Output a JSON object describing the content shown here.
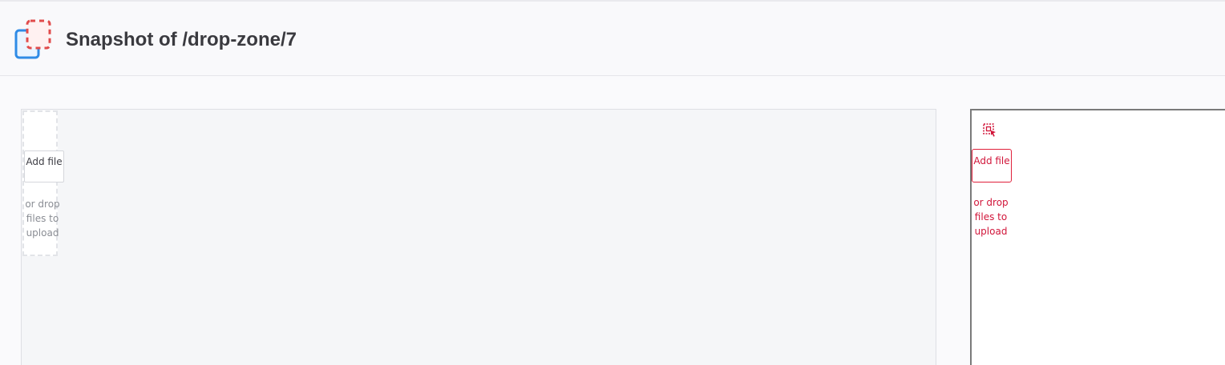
{
  "header": {
    "title": "Snapshot of /drop-zone/7"
  },
  "icons": {
    "logo": "snapshot-logo-icon",
    "select": "dashed-select-icon"
  },
  "left_panel": {
    "add_file_label": "Add file",
    "drop_text": "or drop files to upload"
  },
  "right_panel": {
    "add_file_label": "Add file",
    "drop_text": "or drop files to upload"
  },
  "colors": {
    "accent_red": "#d1163a",
    "logo_blue": "#2f8be6",
    "logo_red": "#e14b4b"
  }
}
